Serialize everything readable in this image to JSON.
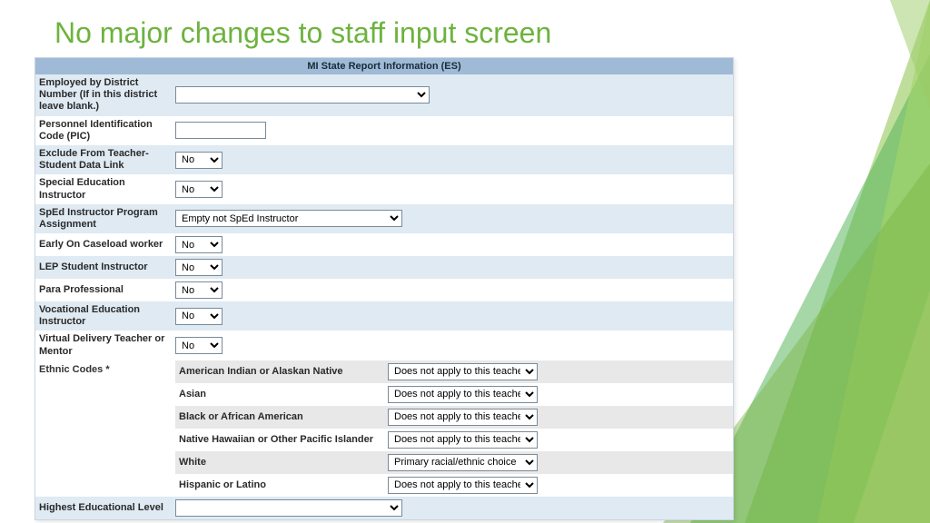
{
  "title": "No major changes to staff input screen",
  "panel_header": "MI State Report Information (ES)",
  "rows": [
    {
      "label": "Employed by District Number (If in this district leave blank.)",
      "ctl": "select-wide",
      "value": ""
    },
    {
      "label": "Personnel Identification Code (PIC)",
      "ctl": "text",
      "value": ""
    },
    {
      "label": "Exclude From Teacher-Student Data Link",
      "ctl": "select-small",
      "value": "No"
    },
    {
      "label": "Special Education Instructor",
      "ctl": "select-small",
      "value": "No"
    },
    {
      "label": "SpEd Instructor Program Assignment",
      "ctl": "select-med",
      "value": "Empty not SpEd Instructor"
    },
    {
      "label": "Early On Caseload worker",
      "ctl": "select-small",
      "value": "No"
    },
    {
      "label": "LEP Student Instructor",
      "ctl": "select-small",
      "value": "No"
    },
    {
      "label": "Para Professional",
      "ctl": "select-small",
      "value": "No"
    },
    {
      "label": "Vocational Education Instructor",
      "ctl": "select-small",
      "value": "No"
    },
    {
      "label": "Virtual Delivery Teacher or Mentor",
      "ctl": "select-small",
      "value": "No"
    }
  ],
  "ethnic_label": "Ethnic Codes *",
  "ethnic": [
    {
      "name": "American Indian or Alaskan Native",
      "value": "Does not apply to this teacher",
      "shade": true
    },
    {
      "name": "Asian",
      "value": "Does not apply to this teacher",
      "shade": false
    },
    {
      "name": "Black or African American",
      "value": "Does not apply to this teacher",
      "shade": true
    },
    {
      "name": "Native Hawaiian or Other Pacific Islander",
      "value": "Does not apply to this teacher",
      "shade": false
    },
    {
      "name": "White",
      "value": "Primary racial/ethnic choice",
      "shade": true
    },
    {
      "name": "Hispanic or Latino",
      "value": "Does not apply to this teacher",
      "shade": false
    }
  ],
  "highest_edu": {
    "label": "Highest Educational Level",
    "value": ""
  }
}
